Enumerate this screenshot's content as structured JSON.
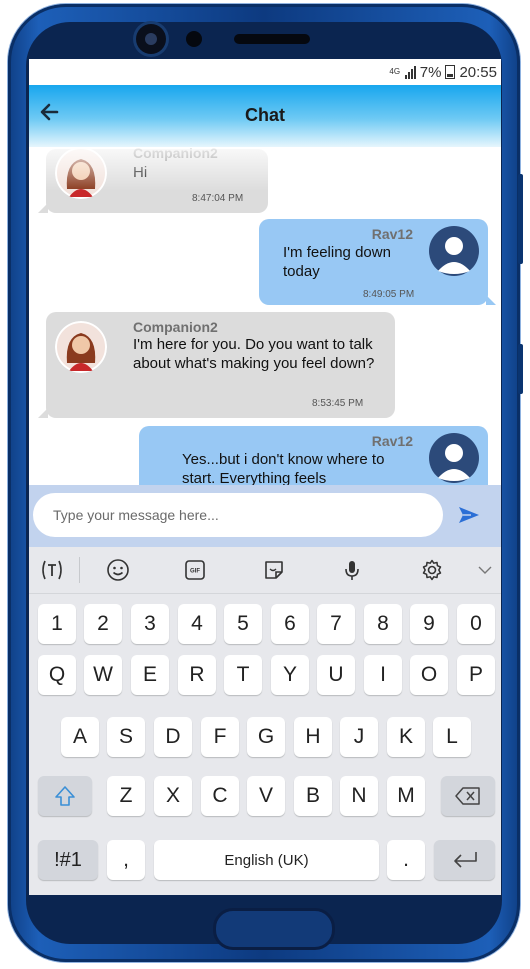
{
  "status_bar": {
    "network": "4G",
    "battery": "7%",
    "time": "20:55"
  },
  "header": {
    "back_icon": "arrow-left-icon",
    "title": "Chat"
  },
  "messages": [
    {
      "sender": "Companion2",
      "text": "Hi",
      "time": "8:47:04 PM",
      "direction": "incoming"
    },
    {
      "sender": "Rav12",
      "text": "I'm feeling down today",
      "time": "8:49:05 PM",
      "direction": "outgoing"
    },
    {
      "sender": "Companion2",
      "text": "I'm here for you. Do you want to talk about what's making you feel down?",
      "time": "8:53:45 PM",
      "direction": "incoming"
    },
    {
      "sender": "Rav12",
      "text": "Yes...but i don't know where to start. Everything feels",
      "time": "",
      "direction": "outgoing"
    }
  ],
  "composer": {
    "placeholder": "Type your message here...",
    "send_icon": "send-icon"
  },
  "keyboard": {
    "toolbar": [
      "text-translate-icon",
      "emoji-icon",
      "gif-icon",
      "sticker-icon",
      "microphone-icon",
      "gear-icon",
      "chevron-down-icon"
    ],
    "row_numbers": [
      "1",
      "2",
      "3",
      "4",
      "5",
      "6",
      "7",
      "8",
      "9",
      "0"
    ],
    "row_q": [
      "Q",
      "W",
      "E",
      "R",
      "T",
      "Y",
      "U",
      "I",
      "O",
      "P"
    ],
    "row_a": [
      "A",
      "S",
      "D",
      "F",
      "G",
      "H",
      "J",
      "K",
      "L"
    ],
    "row_z": [
      "Z",
      "X",
      "C",
      "V",
      "B",
      "N",
      "M"
    ],
    "symbols_label": "!#1",
    "comma": ",",
    "space_label": "English (UK)",
    "period": "."
  },
  "colors": {
    "header_accent": "#18a6ee",
    "outgoing_bubble": "#98c8f4",
    "incoming_bubble": "#dcdcdc",
    "send_icon": "#2b6fd6",
    "phone_body": "#1d5fb8"
  }
}
